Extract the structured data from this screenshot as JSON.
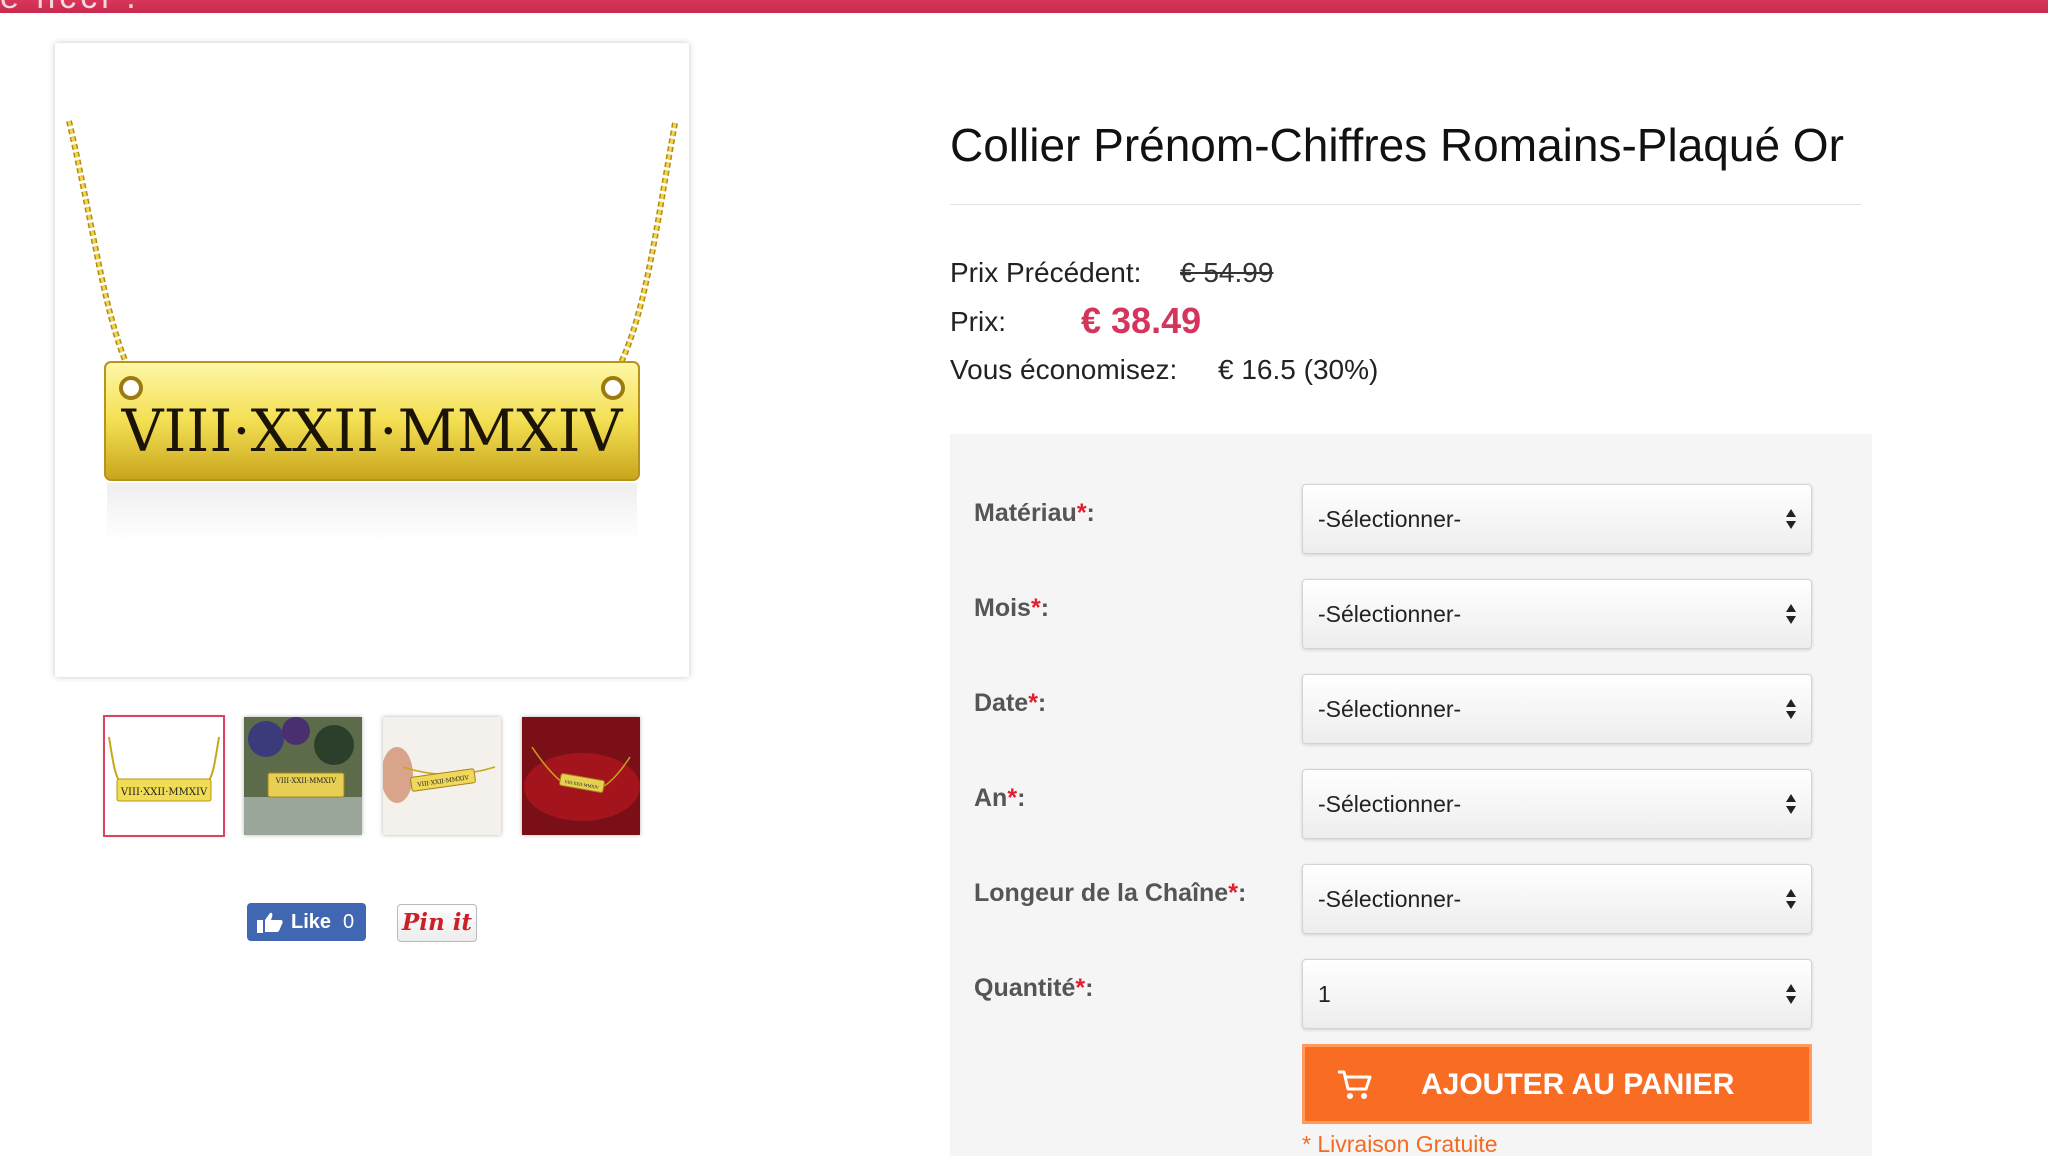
{
  "header": {
    "banner_text": "e nccl ."
  },
  "gallery": {
    "main_image": {
      "icon": "necklace-image",
      "engraving": "VIII·XXII·MMXIV"
    },
    "thumbnails": [
      {
        "label": "VIII·XXII·MMXIV",
        "active": true
      },
      {
        "label": "VIII·XXII·MMXIV",
        "active": false
      },
      {
        "label": "VIII·XXII·MMXIV",
        "active": false
      },
      {
        "label": "VIII·XXII·MMXIV",
        "active": false
      }
    ]
  },
  "social": {
    "like_label": "Like",
    "like_count": "0",
    "pin_label": "Pin it"
  },
  "product": {
    "title": "Collier Prénom-Chiffres Romains-Plaqué Or",
    "old_price_label": "Prix Précédent:",
    "old_price": "€ 54.99",
    "price_label": "Prix:",
    "price": "€ 38.49",
    "saving_label": "Vous économisez:",
    "saving": "€ 16.5 (30%)"
  },
  "options": [
    {
      "label": "Matériau",
      "required": "*",
      "colon": ":",
      "value": "-Sélectionner-"
    },
    {
      "label": "Mois",
      "required": "*",
      "colon": ":",
      "value": "-Sélectionner-"
    },
    {
      "label": "Date",
      "required": "*",
      "colon": ":",
      "value": "-Sélectionner-"
    },
    {
      "label": "An",
      "required": "*",
      "colon": ":",
      "value": "-Sélectionner-"
    },
    {
      "label": "Longeur de la Chaîne",
      "required": "*",
      "colon": ":",
      "value": "-Sélectionner-"
    },
    {
      "label": "Quantité",
      "required": "*",
      "colon": ":",
      "value": "1"
    }
  ],
  "cart": {
    "add_label": "AJOUTER AU PANIER",
    "shipping_note": "* Livraison Gratuite"
  },
  "colors": {
    "accent": "#d5355c",
    "cart": "#f96c24",
    "header": "#d8365a"
  }
}
